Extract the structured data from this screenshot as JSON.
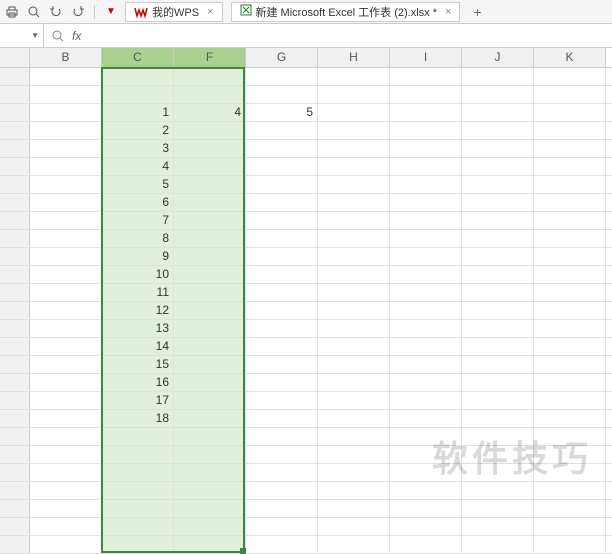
{
  "toolbar": {
    "tabs": [
      {
        "icon": "wps",
        "label": "我的WPS",
        "closable": true
      },
      {
        "icon": "xls",
        "label": "新建 Microsoft Excel 工作表 (2).xlsx *",
        "closable": true
      }
    ]
  },
  "formula_bar": {
    "name_box": "",
    "fx": "fx",
    "formula": ""
  },
  "columns": [
    "B",
    "C",
    "F",
    "G",
    "H",
    "I",
    "J",
    "K"
  ],
  "selected_cols": [
    "C",
    "F"
  ],
  "num_rows": 27,
  "cells": {
    "C": {
      "3": "1",
      "4": "2",
      "5": "3",
      "6": "4",
      "7": "5",
      "8": "6",
      "9": "7",
      "10": "8",
      "11": "9",
      "12": "10",
      "13": "11",
      "14": "12",
      "15": "13",
      "16": "14",
      "17": "15",
      "18": "16",
      "19": "17",
      "20": "18"
    },
    "F": {
      "3": "4"
    },
    "G": {
      "3": "5"
    }
  },
  "watermark": "软件技巧",
  "chart_data": {
    "type": "table",
    "title": "WPS spreadsheet with columns C and F selected",
    "columns": [
      "B",
      "C",
      "F",
      "G",
      "H",
      "I",
      "J",
      "K"
    ],
    "selected_columns": [
      "C",
      "F"
    ],
    "series": [
      {
        "name": "C",
        "values": [
          1,
          2,
          3,
          4,
          5,
          6,
          7,
          8,
          9,
          10,
          11,
          12,
          13,
          14,
          15,
          16,
          17,
          18
        ]
      },
      {
        "name": "F",
        "values": [
          4
        ]
      },
      {
        "name": "G",
        "values": [
          5
        ]
      }
    ]
  }
}
